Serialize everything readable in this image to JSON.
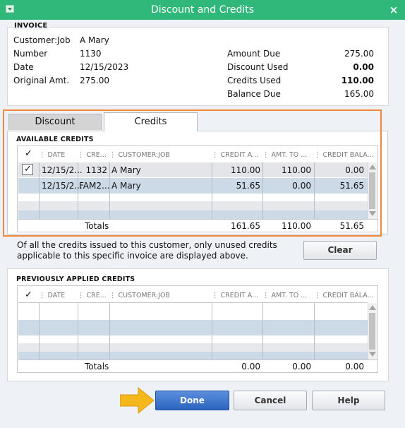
{
  "window": {
    "title": "Discount and Credits",
    "close_glyph": "×"
  },
  "invoice": {
    "heading": "INVOICE",
    "left_fields": [
      {
        "label": "Customer:Job",
        "value": "A Mary"
      },
      {
        "label": "Number",
        "value": "1130"
      },
      {
        "label": "Date",
        "value": "12/15/2023"
      },
      {
        "label": "Original Amt.",
        "value": "275.00"
      }
    ],
    "right_fields": [
      {
        "label": "Amount Due",
        "value": "275.00"
      },
      {
        "label": "Discount Used",
        "value": "0.00"
      },
      {
        "label": "Credits Used",
        "value": "110.00"
      },
      {
        "label": "Balance Due",
        "value": "165.00"
      }
    ]
  },
  "tabs": [
    {
      "label": "Discount",
      "active": false
    },
    {
      "label": "Credits",
      "active": true
    }
  ],
  "available_credits": {
    "title": "AVAILABLE CREDITS",
    "check_header": "✓",
    "columns": [
      "DATE",
      "CRE...",
      "CUSTOMER:JOB",
      "CREDIT A...",
      "AMT. TO ...",
      "CREDIT BALA..."
    ],
    "rows": [
      {
        "checked": true,
        "date": "12/15/2...",
        "ref": "1132",
        "customer": "A Mary",
        "credit_amt": "110.00",
        "amt_to_use": "110.00",
        "balance": "0.00"
      },
      {
        "checked": false,
        "date": "12/15/2...",
        "ref": "FAM2...",
        "customer": "A Mary",
        "credit_amt": "51.65",
        "amt_to_use": "0.00",
        "balance": "51.65"
      }
    ],
    "totals": {
      "label": "Totals",
      "credit_amt": "161.65",
      "amt_to_use": "110.00",
      "balance": "51.65"
    }
  },
  "info_text_line1": "Of all the credits issued to this customer, only unused credits",
  "info_text_line2": "applicable to this specific invoice are displayed above.",
  "clear_button": "Clear",
  "previously_applied": {
    "title": "PREVIOUSLY APPLIED CREDITS",
    "check_header": "✓",
    "columns": [
      "DATE",
      "CRE...",
      "CUSTOMER:JOB",
      "CREDIT A...",
      "AMT. TO ...",
      "CREDIT BALA..."
    ],
    "totals": {
      "label": "Totals",
      "credit_amt": "0.00",
      "amt_to_use": "0.00",
      "balance": "0.00"
    }
  },
  "buttons": {
    "done": "Done",
    "cancel": "Cancel",
    "help": "Help"
  },
  "colors": {
    "titlebar": "#2fb87a",
    "highlight": "#f0873a",
    "done": "#2a64c0",
    "pointer_arrow": "#f5b81c"
  }
}
